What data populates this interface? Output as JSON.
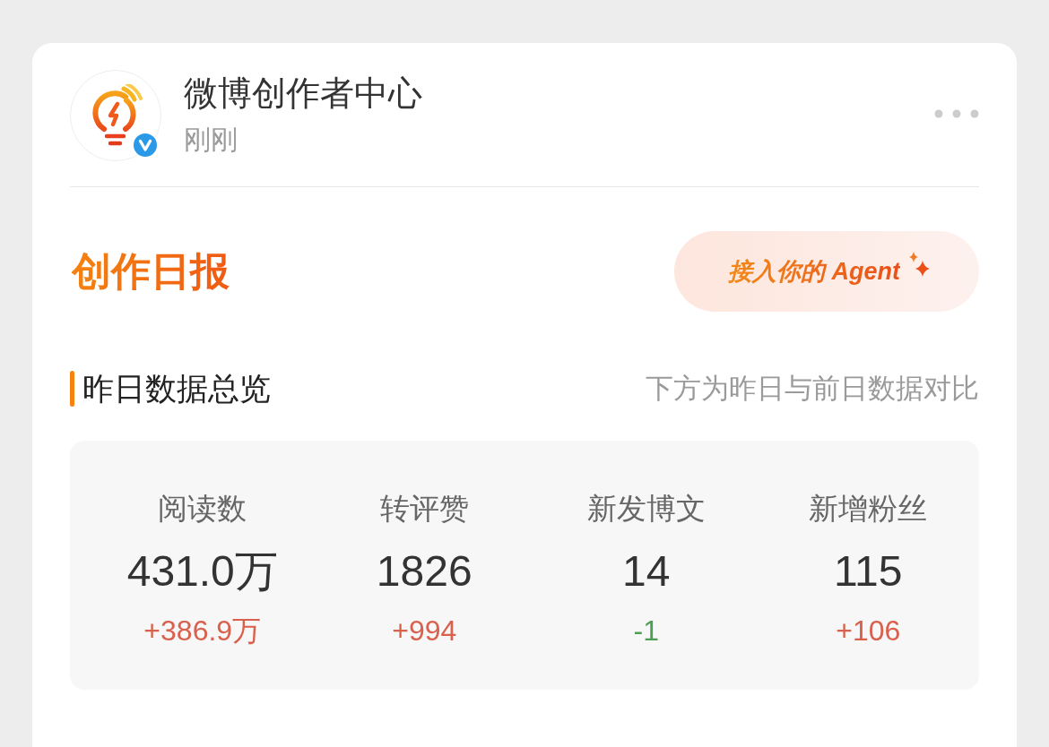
{
  "post": {
    "author": "微博创作者中心",
    "verified": true,
    "time": "刚刚"
  },
  "report": {
    "title": "创作日报",
    "agent_button": "接入你的 Agent"
  },
  "overview": {
    "title": "昨日数据总览",
    "note": "下方为昨日与前日数据对比",
    "stats": [
      {
        "label": "阅读数",
        "value": "431.0万",
        "change": "+386.9万",
        "color": "#d9604c"
      },
      {
        "label": "转评赞",
        "value": "1826",
        "change": "+994",
        "color": "#d9604c"
      },
      {
        "label": "新发博文",
        "value": "14",
        "change": "-1",
        "color": "#4f9d55"
      },
      {
        "label": "新增粉丝",
        "value": "115",
        "change": "+106",
        "color": "#d9604c"
      }
    ]
  }
}
